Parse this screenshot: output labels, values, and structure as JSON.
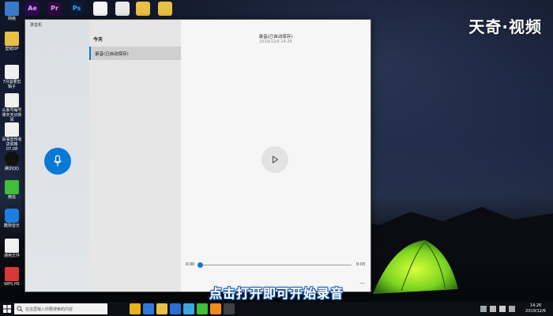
{
  "watermark": "天奇·视频",
  "subtitle": "点击打开即可开始录音",
  "desktop": {
    "top_icons": [
      {
        "label": "Ae",
        "color": "#2b0a4a",
        "text_color": "#d9a7ff"
      },
      {
        "label": "Pr",
        "color": "#2a0b3c",
        "text_color": "#e39bff"
      },
      {
        "label": "Ps",
        "color": "#0a1b33",
        "text_color": "#38a9ff"
      }
    ],
    "left_icons": [
      {
        "caption": "网络",
        "icon": "network-icon"
      },
      {
        "caption": "壁纸DP",
        "icon": "folder-icon"
      },
      {
        "caption": "7月需要剪辑子",
        "icon": "document-icon"
      },
      {
        "caption": "头条号每号课天天识新闻",
        "icon": "document-icon"
      },
      {
        "caption": "百事宣传收货资格07.08",
        "icon": "document-icon"
      },
      {
        "caption": "腾讯QQ",
        "icon": "qq-icon"
      },
      {
        "caption": "微信",
        "icon": "wechat-icon"
      },
      {
        "caption": "酷狗音乐",
        "icon": "kugou-icon"
      },
      {
        "caption": "通用文件",
        "icon": "document-icon"
      },
      {
        "caption": "WPS H5",
        "icon": "wps-icon"
      }
    ]
  },
  "window": {
    "title": "录音机",
    "controls": {
      "minimize": "—",
      "maximize": "☐",
      "close": "✕"
    },
    "list_heading": "今天",
    "list_items": [
      {
        "label": "录音(已自动保存)"
      }
    ],
    "recording": {
      "title": "录音(已自动保存)",
      "timestamp": "2019/12/6 14:26",
      "time_start": "0:00",
      "time_end": "0:03",
      "progress": 0,
      "more": "···"
    }
  },
  "taskbar": {
    "search_placeholder": "在这里输入你要搜索的内容",
    "time": "14:26",
    "date": "2019/12/6",
    "apps": [
      {
        "name": "chrome-icon",
        "color": "#e8b21a"
      },
      {
        "name": "browser-icon",
        "color": "#2f7ad8"
      },
      {
        "name": "folder-icon",
        "color": "#e8c045"
      },
      {
        "name": "app-icon",
        "color": "#2b6fd6"
      },
      {
        "name": "qq-browser-icon",
        "color": "#3aa6e0"
      },
      {
        "name": "wechat-icon",
        "color": "#3fbf3a"
      },
      {
        "name": "app2-icon",
        "color": "#f08a1a"
      },
      {
        "name": "recorder-icon",
        "color": "#404040"
      }
    ]
  },
  "colors": {
    "accent": "#0a78d7",
    "subtitle_outline": "#1d5aa8"
  }
}
